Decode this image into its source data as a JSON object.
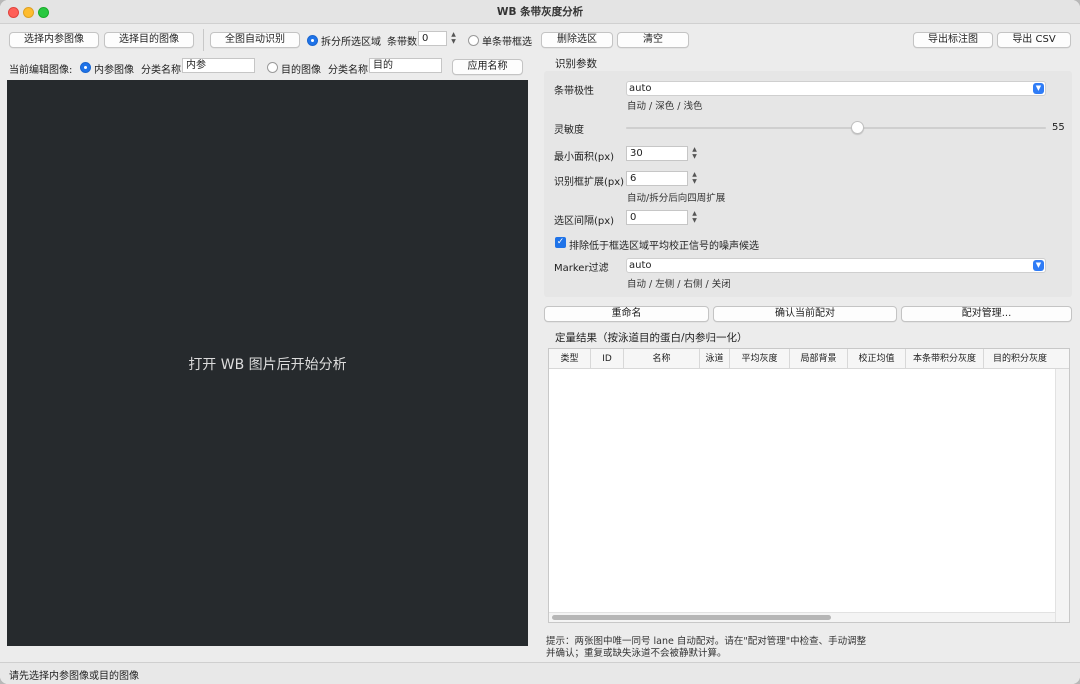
{
  "window": {
    "title": "WB 条带灰度分析"
  },
  "toolbar": {
    "select_ref": "选择内参图像",
    "select_target": "选择目的图像",
    "auto_detect": "全图自动识别",
    "split_mode_label": "拆分所选区域",
    "band_count_label": "条带数",
    "band_count_value": "0",
    "single_band_label": "单条带框选",
    "delete_selection": "删除选区",
    "clear": "清空",
    "export_annotated": "导出标注图",
    "export_csv": "导出 CSV"
  },
  "editbar": {
    "current_label": "当前编辑图像:",
    "ref_radio": "内参图像",
    "ref_class_label": "分类名称",
    "ref_class_value": "内参",
    "target_radio": "目的图像",
    "target_class_label": "分类名称",
    "target_class_value": "目的",
    "apply_name": "应用名称"
  },
  "canvas": {
    "placeholder": "打开 WB 图片后开始分析"
  },
  "params": {
    "section_title": "识别参数",
    "polarity_label": "条带极性",
    "polarity_value": "auto",
    "polarity_hint": "自动 / 深色 / 浅色",
    "sensitivity_label": "灵敏度",
    "sensitivity_value": "55",
    "sensitivity_level": 0.55,
    "min_area_label": "最小面积(px)",
    "min_area_value": "30",
    "expand_label": "识别框扩展(px)",
    "expand_value": "6",
    "expand_hint": "自动/拆分后向四周扩展",
    "gap_label": "选区间隔(px)",
    "gap_value": "0",
    "exclude_checked": true,
    "exclude_label": "排除低于框选区域平均校正信号的噪声候选",
    "marker_label": "Marker过滤",
    "marker_value": "auto",
    "marker_hint": "自动 / 左侧 / 右侧 / 关闭"
  },
  "actions": {
    "rename": "重命名",
    "confirm_pair": "确认当前配对",
    "pair_manage": "配对管理..."
  },
  "results": {
    "title": "定量结果（按泳道目的蛋白/内参归一化）",
    "columns": [
      "类型",
      "ID",
      "名称",
      "泳道",
      "平均灰度",
      "局部背景",
      "校正均值",
      "本条带积分灰度",
      "目的积分灰度"
    ]
  },
  "tip": {
    "line1": "提示：两张图中唯一同号 lane 自动配对。请在\"配对管理\"中检查、手动调整",
    "line2": "并确认；重复或缺失泳道不会被静默计算。"
  },
  "status": {
    "text": "请先选择内参图像或目的图像"
  }
}
